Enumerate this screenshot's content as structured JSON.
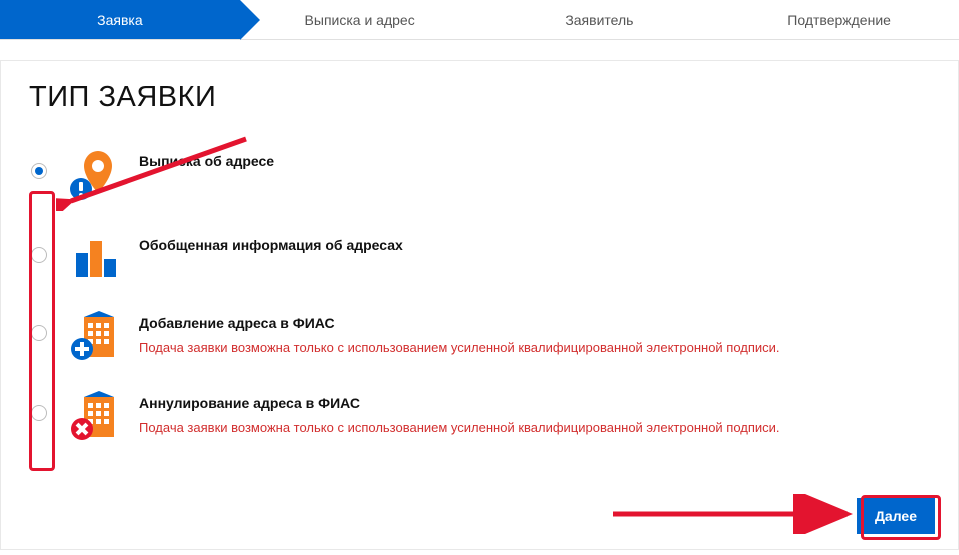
{
  "stepper": {
    "steps": [
      {
        "label": "Заявка",
        "active": true
      },
      {
        "label": "Выписка и адрес",
        "active": false
      },
      {
        "label": "Заявитель",
        "active": false
      },
      {
        "label": "Подтверждение",
        "active": false
      }
    ]
  },
  "section_title": "ТИП ЗАЯВКИ",
  "options": [
    {
      "id": "extract",
      "title": "Выписка об адресе",
      "note": "",
      "selected": true,
      "icon": "pin-info"
    },
    {
      "id": "summary",
      "title": "Обобщенная информация об адресах",
      "note": "",
      "selected": false,
      "icon": "bars"
    },
    {
      "id": "add",
      "title": "Добавление адреса в ФИАС",
      "note": "Подача заявки возможна только с использованием усиленной квалифицированной электронной подписи.",
      "selected": false,
      "icon": "building-plus"
    },
    {
      "id": "annul",
      "title": "Аннулирование адреса в ФИАС",
      "note": "Подача заявки возможна только с использованием усиленной квалифицированной электронной подписи.",
      "selected": false,
      "icon": "building-cross"
    }
  ],
  "next_label": "Далее",
  "annotation_color": "#e3142f"
}
